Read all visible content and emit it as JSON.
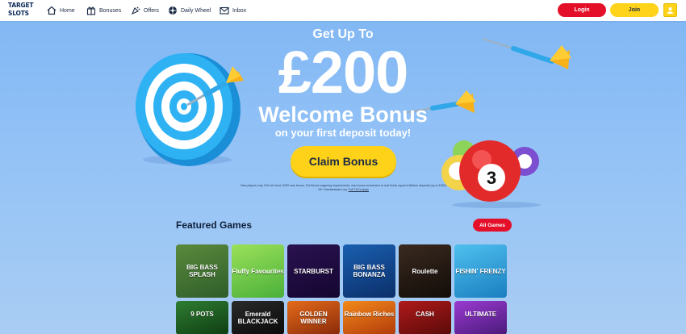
{
  "nav": {
    "logo_line1": "TARGET",
    "logo_line2": "SLOTS",
    "items": [
      {
        "label": "Home",
        "icon": "home-icon"
      },
      {
        "label": "Bonuses",
        "icon": "gift-icon"
      },
      {
        "label": "Offers",
        "icon": "offers-icon"
      },
      {
        "label": "Daily Wheel",
        "icon": "wheel-icon"
      },
      {
        "label": "Inbox",
        "icon": "mail-icon"
      }
    ],
    "login_label": "Login",
    "join_label": "Join",
    "account_icon": "user-icon"
  },
  "hero": {
    "pre": "Get Up To",
    "amount": "£200",
    "title": "Welcome Bonus",
    "subtitle": "on your first deposit today!",
    "cta": "Claim Bonus",
    "terms_main": "New players only, £10 min fund, £200 max bonus, 10x Bonus wagering requirements, max bonus conversion to real funds equal to lifetime deposits (up to £250) 18+ Gambleaware.org.",
    "terms_link": "Full T&Cs apply",
    "ball_number": "3"
  },
  "featured": {
    "title": "Featured Games",
    "all_label": "All Games",
    "games_row1": [
      {
        "title": "BIG BASS SPLASH",
        "colors": [
          "#5a8a3c",
          "#2f5d2a"
        ]
      },
      {
        "title": "Fluffy Favourites",
        "colors": [
          "#9be15a",
          "#4bb03a"
        ]
      },
      {
        "title": "STARBURST",
        "colors": [
          "#2a1250",
          "#140630"
        ]
      },
      {
        "title": "BIG BASS BONANZA",
        "colors": [
          "#1a5fb0",
          "#0b2f6a"
        ]
      },
      {
        "title": "Roulette",
        "colors": [
          "#3a2a20",
          "#120c08"
        ]
      },
      {
        "title": "FISHIN' FRENZY",
        "colors": [
          "#4fc0ef",
          "#1a7fc0"
        ]
      }
    ],
    "games_row2": [
      {
        "title": "9 POTS",
        "colors": [
          "#2e7d32",
          "#0f3d12"
        ]
      },
      {
        "title": "Emerald BLACKJACK",
        "colors": [
          "#2a2a2a",
          "#0a0a0a"
        ]
      },
      {
        "title": "GOLDEN WINNER",
        "colors": [
          "#e46b1a",
          "#8a2a0a"
        ]
      },
      {
        "title": "Rainbow Riches",
        "colors": [
          "#f28a1a",
          "#b23a0a"
        ]
      },
      {
        "title": "CASH",
        "colors": [
          "#b01a1a",
          "#5a0a0a"
        ]
      },
      {
        "title": "ULTIMATE",
        "colors": [
          "#9a3ad0",
          "#4a1a7a"
        ]
      }
    ]
  },
  "colors": {
    "accent_red": "#e4102a",
    "accent_yellow": "#ffd21a",
    "navy": "#0d2a5a"
  }
}
